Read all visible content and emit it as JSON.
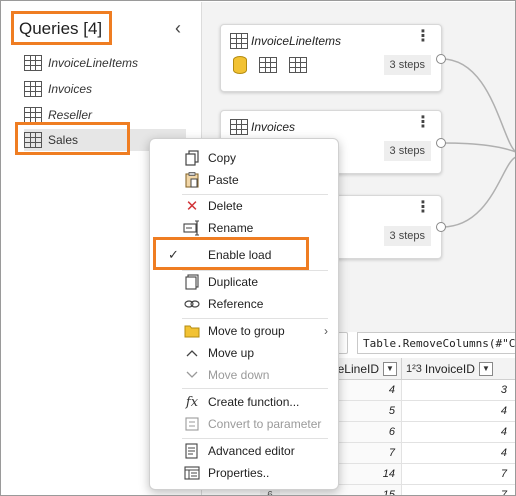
{
  "queries_pane": {
    "title": "Queries [4]",
    "collapse_icon": "chevron-left-icon",
    "items": [
      {
        "label": "InvoiceLineItems"
      },
      {
        "label": "Invoices"
      },
      {
        "label": "Reseller"
      },
      {
        "label": "Sales"
      }
    ]
  },
  "diagram": {
    "cards": [
      {
        "title": "InvoiceLineItems",
        "steps": "3 steps"
      },
      {
        "title": "Invoices",
        "steps": "3 steps"
      },
      {
        "title": "",
        "steps": "3 steps"
      }
    ]
  },
  "formula_bar": {
    "text": "Table.RemoveColumns(#\"Ch"
  },
  "grid": {
    "headers": [
      {
        "type_glyph": "",
        "label": "eLineID"
      },
      {
        "type_glyph": "1²3",
        "label": "InvoiceID"
      }
    ],
    "type_glyph_a": "1²3",
    "rows": [
      {
        "num": "",
        "a": "4",
        "b": "3"
      },
      {
        "num": "",
        "a": "5",
        "b": "4"
      },
      {
        "num": "",
        "a": "6",
        "b": "4"
      },
      {
        "num": "",
        "a": "7",
        "b": "4"
      },
      {
        "num": "",
        "a": "14",
        "b": "7"
      },
      {
        "num": "6",
        "a": "15",
        "b": "7"
      }
    ]
  },
  "context_menu": {
    "items": [
      {
        "label": "Copy",
        "icon": "copy-icon"
      },
      {
        "label": "Paste",
        "icon": "paste-icon"
      },
      {
        "label": "Delete",
        "icon": "delete-icon"
      },
      {
        "label": "Rename",
        "icon": "rename-icon"
      },
      {
        "label": "Enable load",
        "icon": "checkmark-icon",
        "checked": true
      },
      {
        "label": "Duplicate",
        "icon": "duplicate-icon"
      },
      {
        "label": "Reference",
        "icon": "reference-icon"
      },
      {
        "label": "Move to group",
        "icon": "folder-icon",
        "submenu": true
      },
      {
        "label": "Move up",
        "icon": "chevron-up-icon"
      },
      {
        "label": "Move down",
        "icon": "chevron-down-icon",
        "disabled": true
      },
      {
        "label": "Create function...",
        "icon": "fx-icon"
      },
      {
        "label": "Convert to parameter",
        "icon": "parameter-icon",
        "disabled": true
      },
      {
        "label": "Advanced editor",
        "icon": "advanced-editor-icon"
      },
      {
        "label": "Properties..",
        "icon": "properties-icon"
      }
    ]
  },
  "colors": {
    "highlight": "#ef7d22",
    "diagram_bg": "#f3f3f3",
    "db_icon": "#f2c233",
    "delete_red": "#d13438"
  }
}
